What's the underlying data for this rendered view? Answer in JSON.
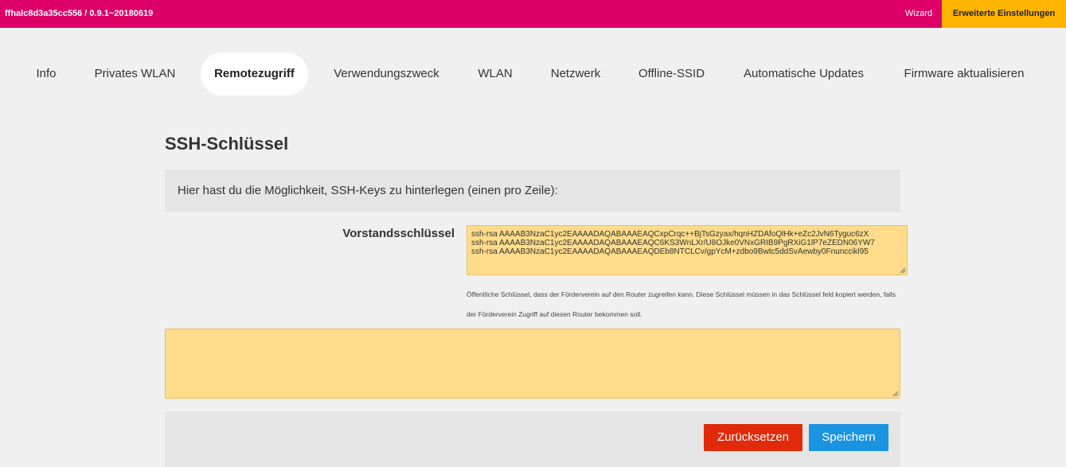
{
  "topbar": {
    "hostname": "ffhalc8d3a35cc556 / 0.9.1~20180619",
    "wizard_label": "Wizard",
    "advanced_label": "Erweiterte Einstellungen",
    "colors": {
      "bar": "#dc0067",
      "advanced": "#ffb400"
    }
  },
  "tabs": [
    {
      "label": "Info"
    },
    {
      "label": "Privates WLAN"
    },
    {
      "label": "Remotezugriff",
      "active": true
    },
    {
      "label": "Verwendungszweck"
    },
    {
      "label": "WLAN"
    },
    {
      "label": "Netzwerk"
    },
    {
      "label": "Offline-SSID"
    },
    {
      "label": "Automatische Updates"
    },
    {
      "label": "Firmware aktualisieren"
    }
  ],
  "section": {
    "title": "SSH-Schlüssel",
    "intro": "Hier hast du die Möglichkeit, SSH-Keys zu hinterlegen (einen pro Zeile):"
  },
  "vorstand": {
    "label": "Vorstandsschlüssel",
    "keys": [
      "ssh-rsa AAAAB3NzaC1yc2EAAAADAQABAAAEAQCxpCrqc++BjTsGzyax/hqnHZDAfoQlHk+eZc2JvN6Tyguc6zX",
      "ssh-rsa AAAAB3NzaC1yc2EAAAADAQABAAAEAQC6KS3WnLXr/U8OJke0VNxGRIB9PgRXiG1lP7eZEDN06YW7",
      "ssh-rsa AAAAB3NzaC1yc2EAAAADAQABAAAEAQDEb8NTCLCv/gpYcM+zdbo9Bwtc5ddSvAewby0Fnunccikl95"
    ],
    "help": "Öffentliche Schlüssel, dass der Förderverein auf den Router zugreifen kann. Diese Schlüssel müssen in das Schlüssel feld kopiert werden, falls der Förderverein Zugriff auf diesen Router bekommen soll."
  },
  "custom_keys": {
    "value": ""
  },
  "actions": {
    "reset_label": "Zurücksetzen",
    "save_label": "Speichern",
    "colors": {
      "reset": "#e02a0a",
      "save": "#1a94e0"
    }
  }
}
